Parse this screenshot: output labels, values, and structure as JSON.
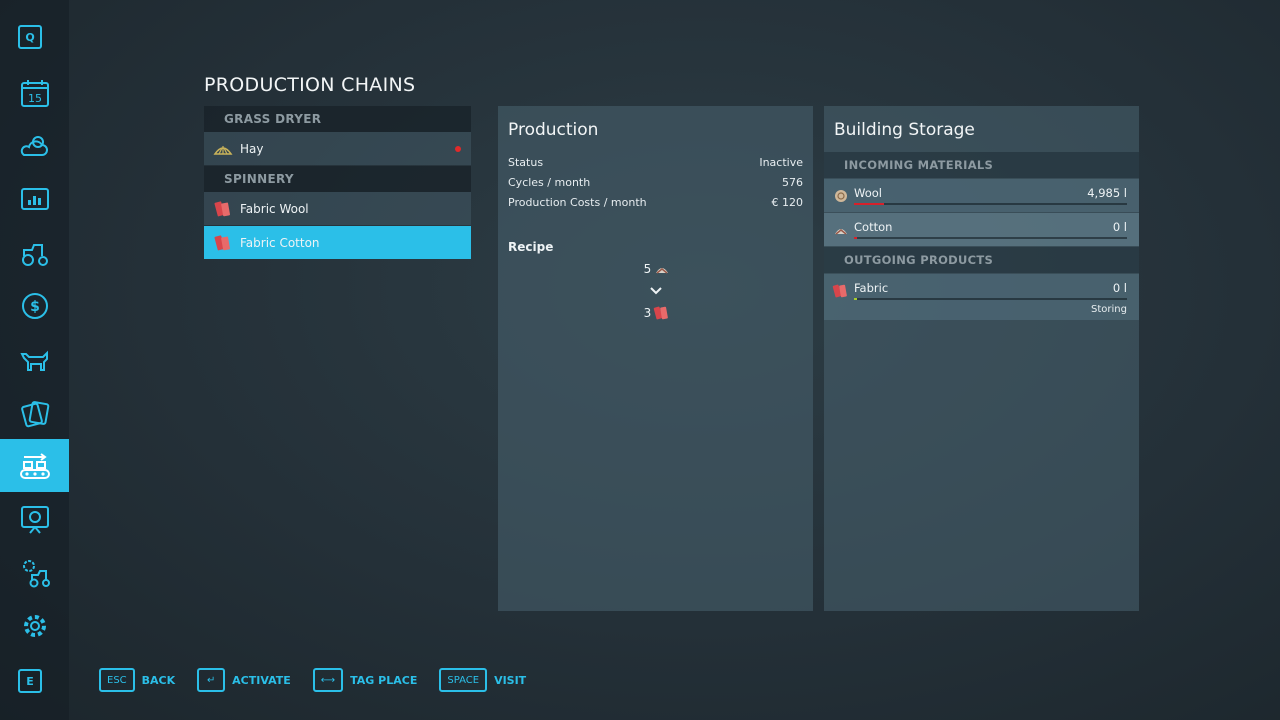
{
  "sidebar": {
    "top_key": "Q",
    "bottom_key": "E",
    "calendar_day": "15",
    "items": [
      {
        "name": "calendar-icon"
      },
      {
        "name": "weather-icon"
      },
      {
        "name": "statistics-icon"
      },
      {
        "name": "vehicles-icon"
      },
      {
        "name": "finances-icon"
      },
      {
        "name": "animals-icon"
      },
      {
        "name": "contracts-icon"
      },
      {
        "name": "production-icon",
        "active": true
      },
      {
        "name": "help-icon"
      },
      {
        "name": "garage-icon"
      },
      {
        "name": "settings-icon"
      }
    ]
  },
  "page_title": "PRODUCTION CHAINS",
  "chains": [
    {
      "group": "GRASS DRYER",
      "items": [
        {
          "label": "Hay",
          "icon": "hay-icon",
          "alert": true
        }
      ]
    },
    {
      "group": "SPINNERY",
      "items": [
        {
          "label": "Fabric Wool",
          "icon": "fabric-icon"
        },
        {
          "label": "Fabric Cotton",
          "icon": "fabric-icon",
          "selected": true
        }
      ]
    }
  ],
  "production": {
    "title": "Production",
    "stats": [
      {
        "label": "Status",
        "value": "Inactive"
      },
      {
        "label": "Cycles / month",
        "value": "576"
      },
      {
        "label": "Production Costs / month",
        "value": "€ 120"
      }
    ],
    "recipe_label": "Recipe",
    "recipe_input": {
      "amount": "5",
      "icon": "cotton-icon"
    },
    "recipe_output": {
      "amount": "3",
      "icon": "fabric-icon"
    }
  },
  "storage": {
    "title": "Building Storage",
    "incoming_header": "INCOMING MATERIALS",
    "incoming": [
      {
        "name": "Wool",
        "amount": "4,985 l",
        "fill": 0.11,
        "icon": "wool-icon"
      },
      {
        "name": "Cotton",
        "amount": "0 l",
        "fill": 0.01,
        "icon": "cotton-icon"
      }
    ],
    "outgoing_header": "OUTGOING PRODUCTS",
    "outgoing": [
      {
        "name": "Fabric",
        "amount": "0 l",
        "fill": 0.01,
        "icon": "fabric-icon",
        "mode": "Storing"
      }
    ]
  },
  "footer": [
    {
      "key": "ESC",
      "label": "BACK"
    },
    {
      "key": "↵",
      "label": "ACTIVATE"
    },
    {
      "key": "⟷",
      "label": "TAG PLACE"
    },
    {
      "key": "SPACE",
      "label": "VISIT"
    }
  ],
  "colors": {
    "accent": "#2bbfe8",
    "alert": "#e02a2a",
    "fill_red": "#d8202a",
    "fill_green": "#a6cc2e"
  }
}
